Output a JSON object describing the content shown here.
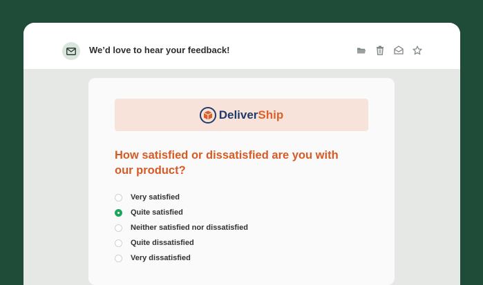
{
  "email": {
    "subject": "We’d love to hear your feedback!",
    "icons": [
      "mail-icon",
      "folder-icon",
      "trash-icon",
      "mark-read-icon",
      "star-icon"
    ]
  },
  "brand": {
    "name_part1": "Deliver",
    "name_part2": "Ship",
    "primary_color": "#1f3b6b",
    "accent_color": "#d9622b"
  },
  "survey": {
    "question": "How satisfied or dissatisfied are you with our product?",
    "selected_index": 1,
    "options": [
      {
        "label": "Very satisfied"
      },
      {
        "label": "Quite satisfied"
      },
      {
        "label": "Neither satisfied nor dissatisfied"
      },
      {
        "label": "Quite dissatisfied"
      },
      {
        "label": "Very dissatisfied"
      }
    ]
  },
  "colors": {
    "frame": "#1f4b39",
    "question": "#d75a22",
    "radio_selected": "#1fa65c"
  }
}
